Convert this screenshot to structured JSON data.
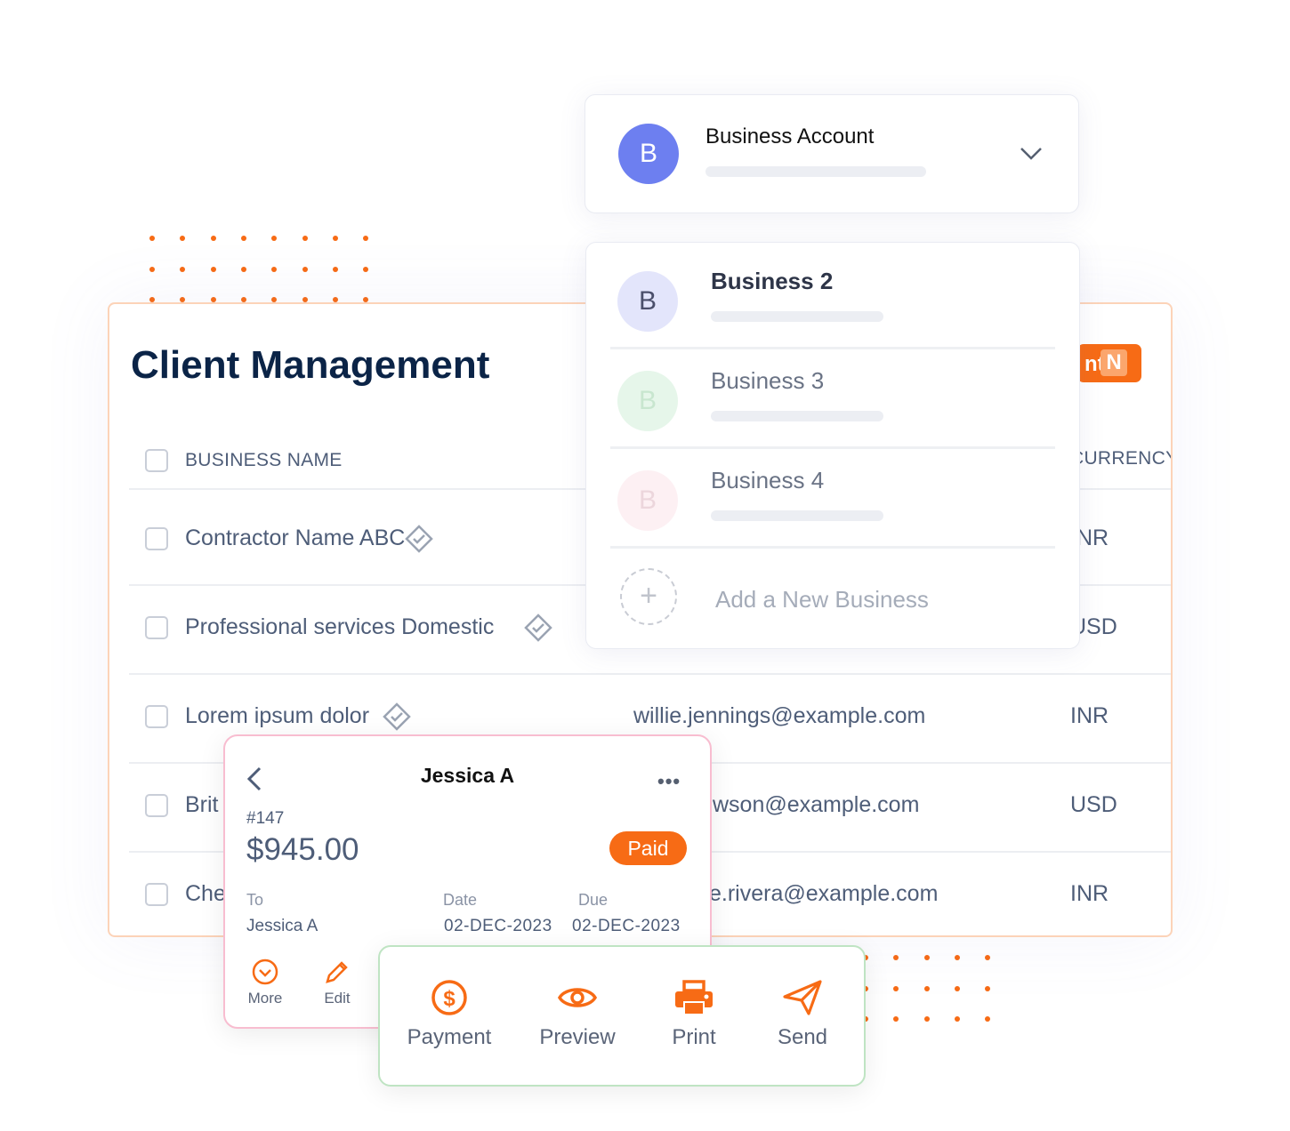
{
  "colors": {
    "accent": "#f76b15",
    "navy": "#0b2447",
    "avatar": "#6d7ff0"
  },
  "client_management": {
    "title": "Client Management",
    "add_button_label": "nt",
    "add_button_badge": "N",
    "columns": {
      "business_name": "BUSINESS NAME",
      "currency": "CURRENCY"
    },
    "rows": [
      {
        "name": "Contractor Name ABC",
        "email": "",
        "currency": "INR",
        "verified": true
      },
      {
        "name": "Professional services Domestic",
        "email": "",
        "currency": "USD",
        "verified": true
      },
      {
        "name": "Lorem ipsum dolor",
        "email": "willie.jennings@example.com",
        "currency": "INR",
        "verified": true
      },
      {
        "name": "Brit",
        "email": "wson@example.com",
        "currency": "USD"
      },
      {
        "name": "Che",
        "email": "e.rivera@example.com",
        "currency": "INR"
      }
    ]
  },
  "account_switcher": {
    "current": {
      "initial": "B",
      "name": "Business Account"
    },
    "options": [
      {
        "initial": "B",
        "name": "Business 2"
      },
      {
        "initial": "B",
        "name": "Business 3"
      },
      {
        "initial": "B",
        "name": "Business 4"
      }
    ],
    "add_label": "Add a New Business"
  },
  "invoice": {
    "title": "Jessica A",
    "number": "#147",
    "amount": "$945.00",
    "status": "Paid",
    "to_label": "To",
    "to_value": "Jessica A",
    "date_label": "Date",
    "date_value": "02-DEC-2023",
    "due_label": "Due",
    "due_value": "02-DEC-2023",
    "more_label": "More",
    "edit_label": "Edit"
  },
  "actions": [
    {
      "label": "Payment",
      "icon": "dollar-circle-icon"
    },
    {
      "label": "Preview",
      "icon": "eye-icon"
    },
    {
      "label": "Print",
      "icon": "printer-icon"
    },
    {
      "label": "Send",
      "icon": "send-icon"
    }
  ]
}
